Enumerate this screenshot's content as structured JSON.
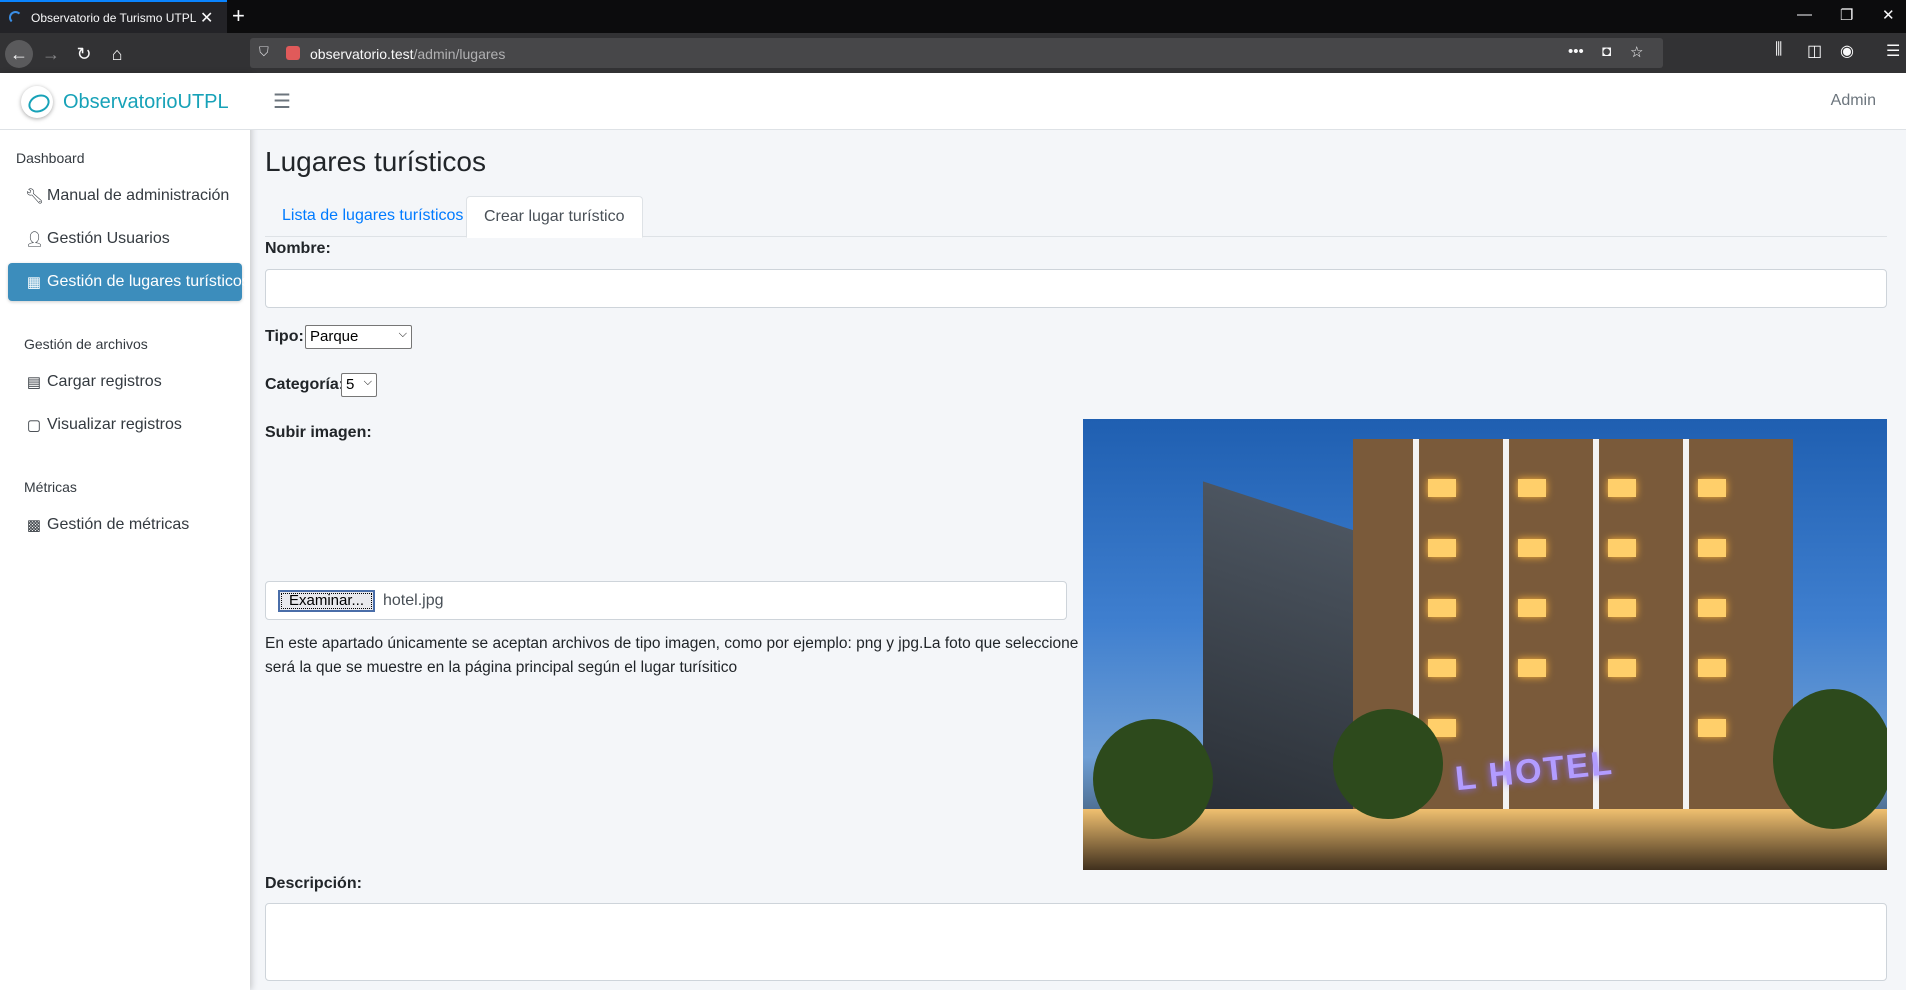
{
  "browser": {
    "tab_title": "Observatorio de Turismo UTPL",
    "url_host": "observatorio.test",
    "url_path": "/admin/lugares"
  },
  "sidebar": {
    "brand_main": "Observatorio",
    "brand_suffix": "UTPL",
    "header_dashboard": "Dashboard",
    "items_main": [
      {
        "label": "Manual de administración",
        "icon": "wrench-icon"
      },
      {
        "label": "Gestión Usuarios",
        "icon": "user-icon"
      },
      {
        "label": "Gestión de lugares turísticos",
        "icon": "building-icon",
        "active": true
      }
    ],
    "header_archivos": "Gestión de archivos",
    "items_archivos": [
      {
        "label": "Cargar registros",
        "icon": "file-upload-icon"
      },
      {
        "label": "Visualizar registros",
        "icon": "file-icon"
      }
    ],
    "header_metricas": "Métricas",
    "items_metricas": [
      {
        "label": "Gestión de métricas",
        "icon": "calculator-icon"
      }
    ]
  },
  "header": {
    "user": "Admin"
  },
  "main": {
    "title": "Lugares turísticos",
    "tabs": [
      {
        "label": "Lista de lugares turísticos",
        "active": false
      },
      {
        "label": "Crear lugar turístico",
        "active": true
      }
    ],
    "form": {
      "nombre_label": "Nombre:",
      "nombre_value": "",
      "tipo_label": "Tipo:",
      "tipo_value": "Parque",
      "categoria_label": "Categoría:",
      "categoria_value": "5",
      "imagen_label": "Subir imagen:",
      "file_button": "Examinar...",
      "file_name": "hotel.jpg",
      "help_text": "En este apartado únicamente se aceptan archivos de tipo imagen, como por ejemplo: png y jpg.La foto que seleccione será la que se muestre en la página principal según el lugar turísitico",
      "preview_sign": "L HOTEL",
      "descripcion_label": "Descripción:",
      "descripcion_value": ""
    }
  },
  "colors": {
    "accent": "#3c8dbc",
    "brand": "#17a2b8",
    "link": "#007bff"
  }
}
